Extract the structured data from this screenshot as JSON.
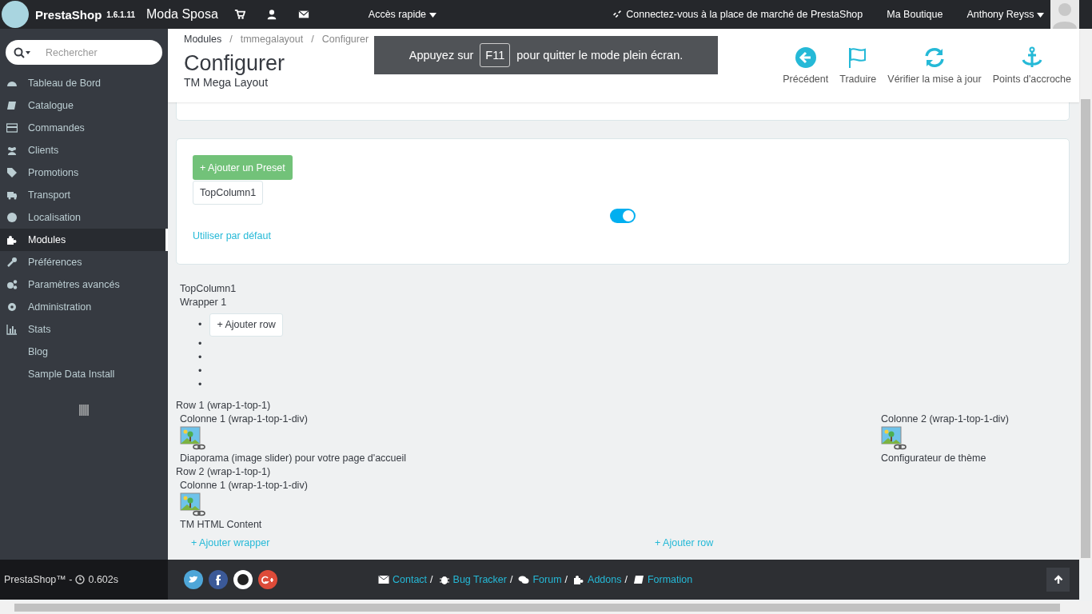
{
  "topbar": {
    "brand": "PrestaShop",
    "version": "1.6.1.11",
    "shop": "Moda Sposa",
    "quick_access": "Accès rapide",
    "marketplace": "Connectez-vous à la place de marché de PrestaShop",
    "my_shop": "Ma Boutique",
    "user": "Anthony Reyss"
  },
  "sidebar": {
    "search": {
      "placeholder": "Rechercher"
    },
    "items": [
      {
        "label": "Tableau de Bord",
        "selected": false
      },
      {
        "label": "Catalogue",
        "selected": false
      },
      {
        "label": "Commandes",
        "selected": false
      },
      {
        "label": "Clients",
        "selected": false
      },
      {
        "label": "Promotions",
        "selected": false
      },
      {
        "label": "Transport",
        "selected": false
      },
      {
        "label": "Localisation",
        "selected": false
      },
      {
        "label": "Modules",
        "selected": true
      },
      {
        "label": "Préférences",
        "selected": false
      },
      {
        "label": "Paramètres avancés",
        "selected": false
      },
      {
        "label": "Administration",
        "selected": false
      },
      {
        "label": "Stats",
        "selected": false
      },
      {
        "label": "Blog",
        "selected": false
      },
      {
        "label": "Sample Data Install",
        "selected": false
      }
    ]
  },
  "header": {
    "separator": "/",
    "breadcrumb": [
      "Modules",
      "tmmegalayout",
      "Configurer"
    ],
    "title": "Configurer",
    "subtitle": "TM Mega Layout",
    "toolbar": [
      "Précédent",
      "Traduire",
      "Vérifier la mise à jour",
      "Points d'accroche"
    ]
  },
  "fullscreen_notice": {
    "before": "Appuyez sur",
    "key": "F11",
    "after": "pour quitter le mode plein écran."
  },
  "preset_panel": {
    "add_button": "+ Ajouter un Preset",
    "preset_tab": "TopColumn1",
    "toggle_on": true,
    "default_link": "Utiliser par défaut"
  },
  "layout": {
    "position": "TopColumn1",
    "wrapper": "Wrapper 1",
    "items": [
      {
        "bullet": "•",
        "add_row_button": "+ Ajouter row"
      },
      {
        "bullet": "•"
      },
      {
        "bullet": "•"
      },
      {
        "bullet": "•"
      },
      {
        "bullet": "•"
      }
    ],
    "rows": [
      {
        "label": "Row 1 (wrap-1-top-1)",
        "columns": [
          {
            "label": "Colonne 1 (wrap-1-top-1-div)",
            "module": "Diaporama (image slider) pour votre page d'accueil"
          },
          {
            "label": "Colonne 2 (wrap-1-top-1-div)",
            "module": "Configurateur de thème"
          }
        ]
      },
      {
        "label": "Row 2 (wrap-1-top-1)",
        "columns": [
          {
            "label": "Colonne 1 (wrap-1-top-1-div)",
            "module": "TM HTML Content"
          }
        ]
      }
    ],
    "add_wrapper_link": "+ Ajouter wrapper",
    "add_row_link": "+ Ajouter row"
  },
  "footer": {
    "brand": "PrestaShop™ -",
    "time": "0.602s",
    "separator": "/",
    "links": [
      "Contact",
      "Bug Tracker",
      "Forum",
      "Addons",
      "Formation"
    ]
  }
}
